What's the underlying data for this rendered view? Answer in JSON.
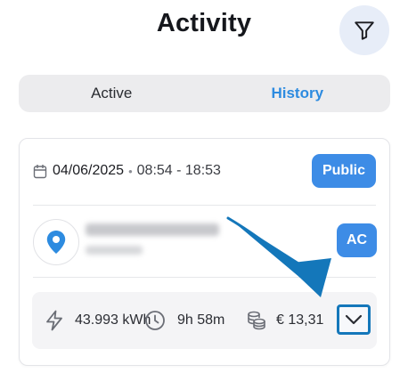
{
  "header": {
    "title": "Activity",
    "filter_icon": "filter-icon"
  },
  "tabs": [
    {
      "label": "Active",
      "active": false
    },
    {
      "label": "History",
      "active": true
    }
  ],
  "session": {
    "date": "04/06/2025",
    "time_range": "08:54 - 18:53",
    "access_badge": "Public",
    "location": {
      "icon": "map-pin-icon",
      "name_blurred": true,
      "address_blurred": true
    },
    "current_type_badge": "AC",
    "stats": {
      "energy": "43.993 kWh",
      "duration": "9h 58m",
      "cost": "€ 13,31"
    },
    "expand_icon": "chevron-down-icon"
  },
  "colors": {
    "accent": "#3d8ce6",
    "tab_active": "#2d8be0",
    "annotation_arrow": "#1477ba"
  }
}
